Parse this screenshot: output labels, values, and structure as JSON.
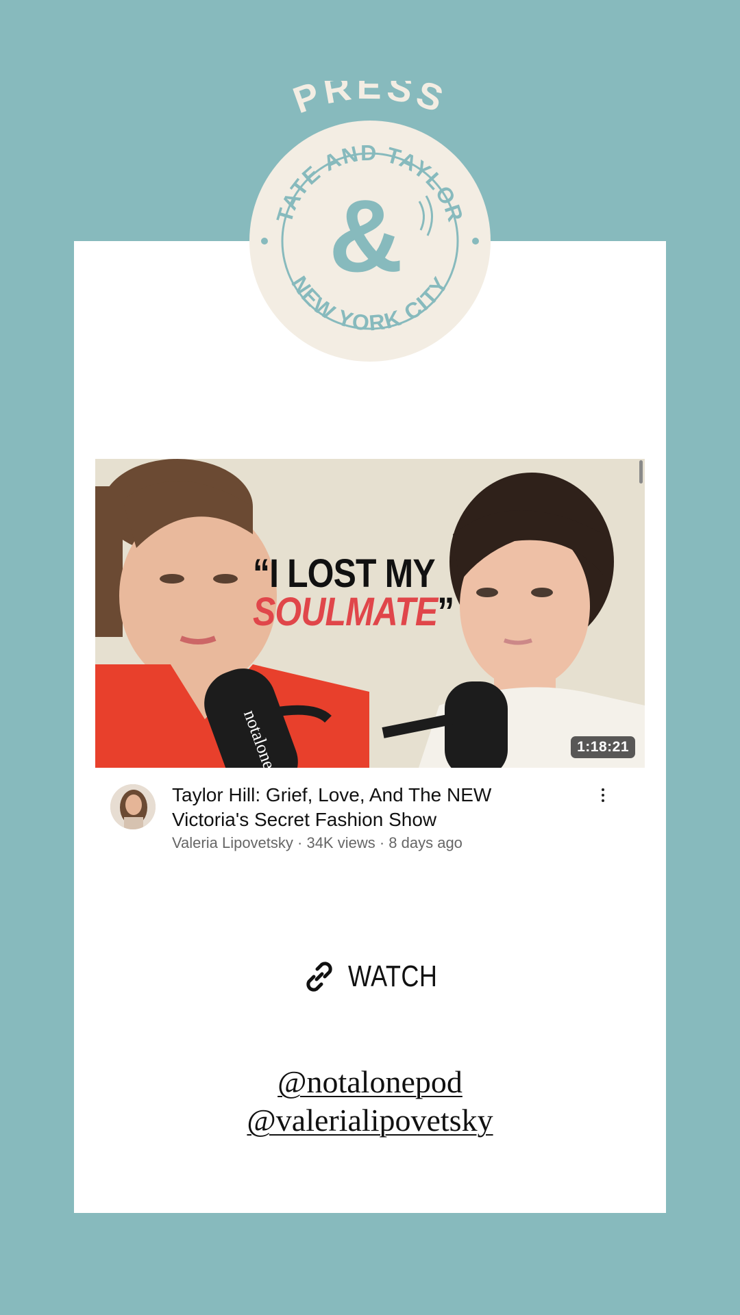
{
  "badge": {
    "top_word": "PRESS",
    "ring_top": "TATE AND TAYLOR",
    "ring_bottom": "NEW YORK CITY",
    "center_glyph": "&"
  },
  "video": {
    "thumbnail_text_line1": "“I LOST MY",
    "thumbnail_text_line2": "SOULMATE",
    "thumbnail_close_quote": "”",
    "mic_brand": "notalone",
    "duration": "1:18:21",
    "title_line1": "Taylor Hill: Grief, Love, And The NEW",
    "title_line2": "Victoria's Secret Fashion Show",
    "meta": "Valeria Lipovetsky · 34K views · 8 days ago"
  },
  "watch": {
    "label": "WATCH",
    "icon": "link-icon"
  },
  "handles": [
    "@notalonepod",
    "@valerialipovetsky"
  ],
  "colors": {
    "background": "#87babd",
    "badge_fill": "#f3ede3",
    "badge_ink": "#87babd",
    "card": "#ffffff",
    "accent_red": "#e0464a"
  }
}
